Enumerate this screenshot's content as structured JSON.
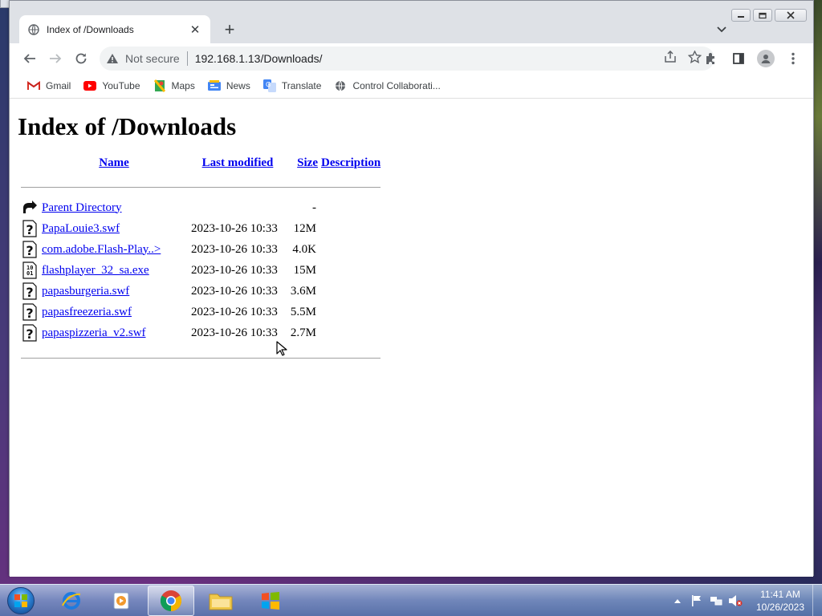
{
  "browser": {
    "tab": {
      "title": "Index of /Downloads",
      "close_label": "✕"
    },
    "new_tab_label": "+",
    "omnibox": {
      "security_label": "Not secure",
      "url": "192.168.1.13/Downloads/"
    },
    "bookmarks": [
      {
        "label": "Gmail",
        "icon": "gmail-icon"
      },
      {
        "label": "YouTube",
        "icon": "youtube-icon"
      },
      {
        "label": "Maps",
        "icon": "maps-icon"
      },
      {
        "label": "News",
        "icon": "news-icon"
      },
      {
        "label": "Translate",
        "icon": "translate-icon"
      },
      {
        "label": "Control Collaborati...",
        "icon": "globe-icon"
      }
    ]
  },
  "page": {
    "heading": "Index of /Downloads",
    "columns": {
      "name": "Name",
      "last_modified": "Last modified",
      "size": "Size",
      "description": "Description"
    },
    "parent": {
      "name": "Parent Directory",
      "size": "-"
    },
    "files": [
      {
        "name": "PapaLouie3.swf",
        "modified": "2023-10-26 10:33",
        "size": "12M",
        "icon": "unknown-file-icon"
      },
      {
        "name": "com.adobe.Flash-Play..>",
        "modified": "2023-10-26 10:33",
        "size": "4.0K",
        "icon": "unknown-file-icon"
      },
      {
        "name": "flashplayer_32_sa.exe",
        "modified": "2023-10-26 10:33",
        "size": "15M",
        "icon": "binary-file-icon"
      },
      {
        "name": "papasburgeria.swf",
        "modified": "2023-10-26 10:33",
        "size": "3.6M",
        "icon": "unknown-file-icon"
      },
      {
        "name": "papasfreezeria.swf",
        "modified": "2023-10-26 10:33",
        "size": "5.5M",
        "icon": "unknown-file-icon"
      },
      {
        "name": "papaspizzeria_v2.swf",
        "modified": "2023-10-26 10:33",
        "size": "2.7M",
        "icon": "unknown-file-icon"
      }
    ]
  },
  "taskbar": {
    "apps": [
      "internet-explorer",
      "media-player",
      "chrome",
      "file-explorer",
      "windows-store"
    ],
    "clock": {
      "time": "11:41 AM",
      "date": "10/26/2023"
    }
  },
  "colors": {
    "link": "#0000ee",
    "chrome_frame": "#dee1e6",
    "omnibox_bg": "#f1f3f4"
  }
}
